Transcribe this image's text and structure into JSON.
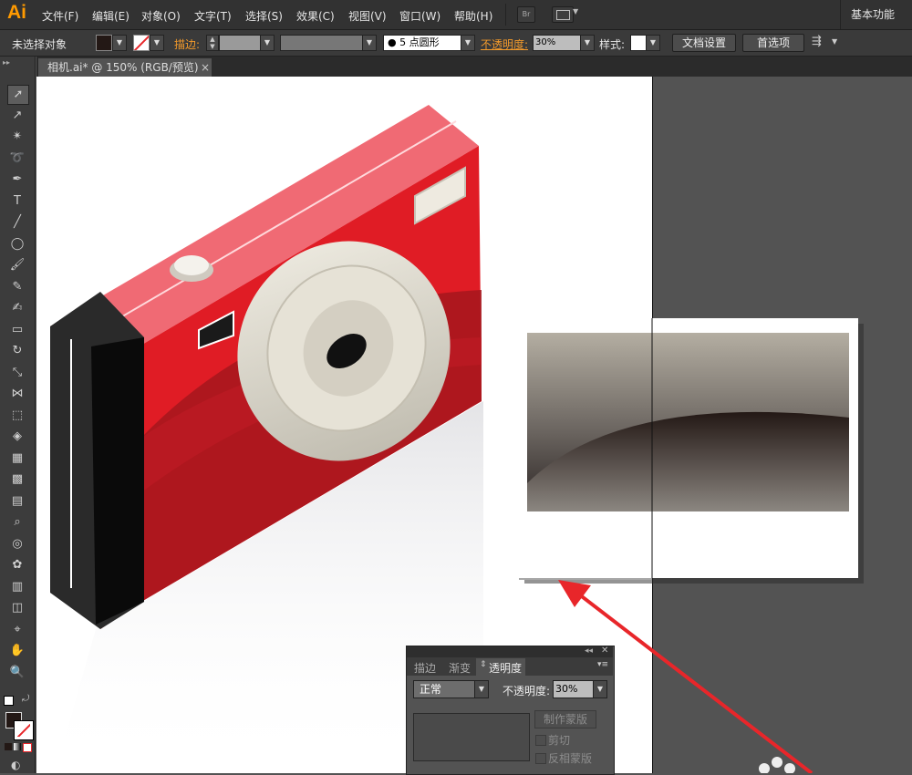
{
  "app": {
    "logo": "Ai"
  },
  "menu": [
    "文件(F)",
    "编辑(E)",
    "对象(O)",
    "文字(T)",
    "选择(S)",
    "效果(C)",
    "视图(V)",
    "窗口(W)",
    "帮助(H)"
  ],
  "bridge_label": "Br",
  "workspace": "基本功能",
  "control": {
    "selection_status": "未选择对象",
    "stroke_label": "描边:",
    "brush": "5 点圆形",
    "opacity_label": "不透明度:",
    "opacity_value": "30%",
    "style_label": "样式:",
    "doc_setup": "文档设置",
    "preferences": "首选项"
  },
  "document_tab": {
    "title": "相机.ai* @ 150% (RGB/预览)",
    "close": "×"
  },
  "tools": [
    "selection-tool",
    "direct-selection-tool",
    "magic-wand-tool",
    "lasso-tool",
    "pen-tool",
    "type-tool",
    "line-tool",
    "ellipse-tool",
    "paintbrush-tool",
    "pencil-tool",
    "blob-brush-tool",
    "eraser-tool",
    "rotate-tool",
    "scale-tool",
    "width-tool",
    "free-transform-tool",
    "shape-builder-tool",
    "perspective-grid-tool",
    "mesh-tool",
    "gradient-tool",
    "eyedropper-tool",
    "blend-tool",
    "symbol-sprayer-tool",
    "column-graph-tool",
    "artboard-tool",
    "slice-tool",
    "hand-tool",
    "zoom-tool"
  ],
  "tool_glyphs": [
    "➚",
    "↗",
    "✴",
    "➰",
    "✒",
    "T",
    "╱",
    "◯",
    "🖌",
    "✎",
    "✍",
    "▭",
    "↻",
    "⤡",
    "⋈",
    "⬚",
    "◈",
    "▦",
    "▩",
    "▤",
    "⌕",
    "◎",
    "✿",
    "▥",
    "◫",
    "⌖",
    "✋",
    "🔍"
  ],
  "transparency_panel": {
    "tabs": [
      "描边",
      "渐变",
      "透明度"
    ],
    "blend_mode": "正常",
    "opacity_label": "不透明度:",
    "opacity_value": "30%",
    "make_mask": "制作蒙版",
    "clip": "剪切",
    "invert_mask": "反相蒙版"
  },
  "colors": {
    "accent": "#ff9a00",
    "camera_red": "#e01c25",
    "arrow": "#e8262a"
  }
}
